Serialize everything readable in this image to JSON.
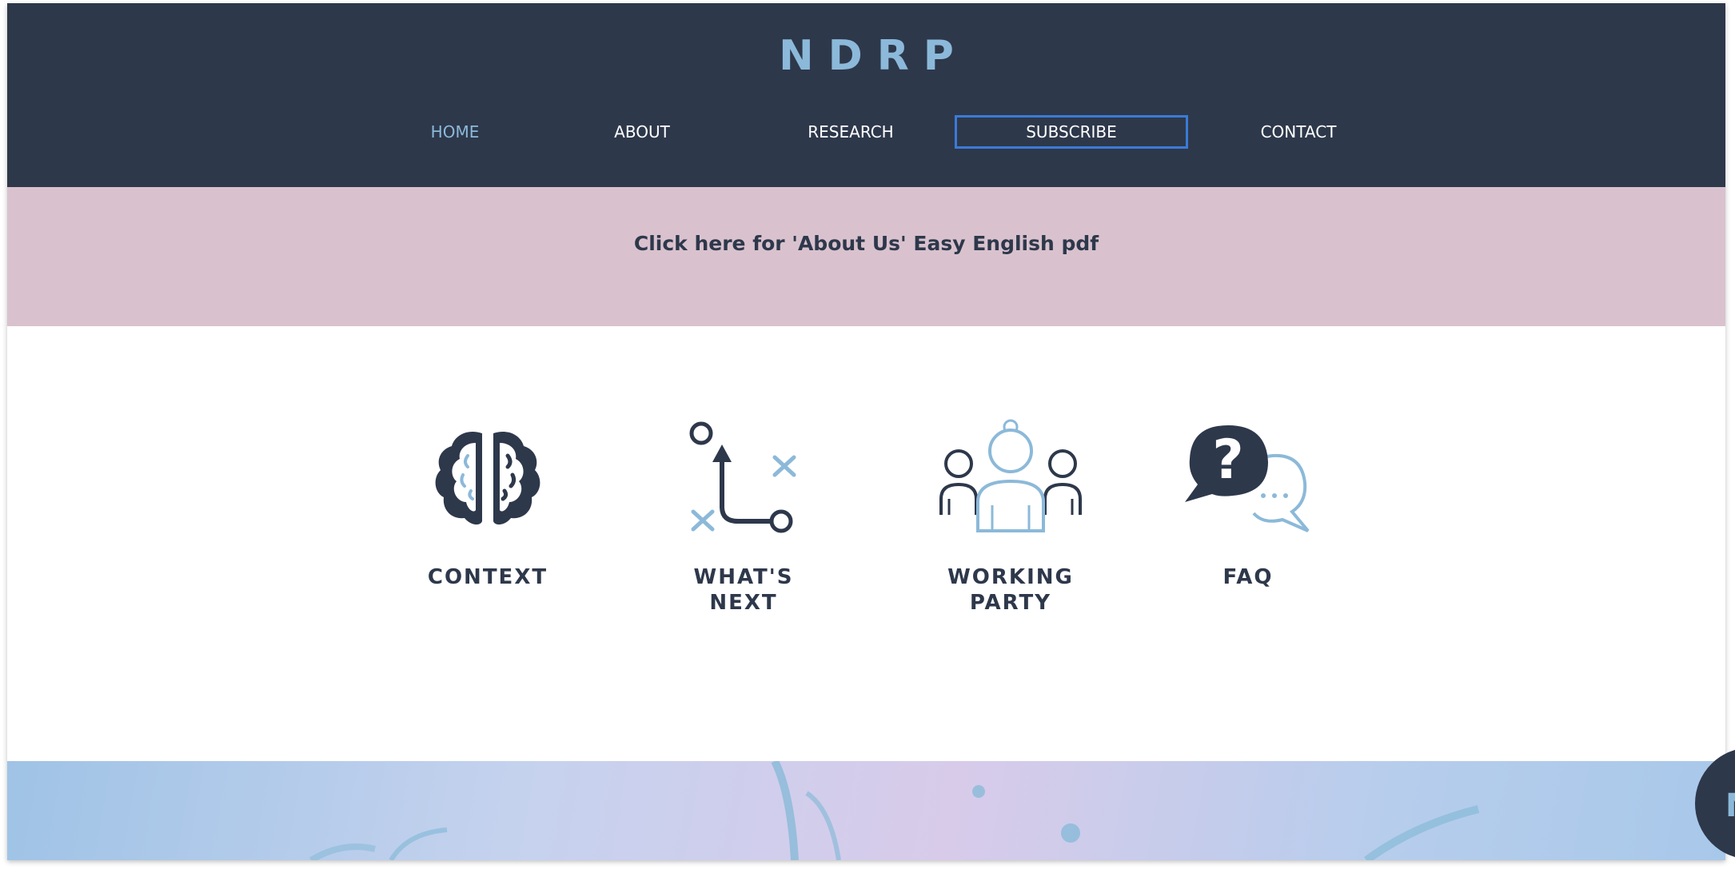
{
  "header": {
    "logo": "NDRP",
    "nav": [
      {
        "label": "HOME"
      },
      {
        "label": "ABOUT"
      },
      {
        "label": "RESEARCH"
      },
      {
        "label": "SUBSCRIBE"
      },
      {
        "label": "CONTACT"
      }
    ]
  },
  "banner": {
    "link_text": "Click here for 'About Us' Easy English pdf"
  },
  "features": [
    {
      "label": "CONTEXT",
      "icon": "brain-icon"
    },
    {
      "label": "WHAT'S\nNEXT",
      "icon": "path-arrow-icon"
    },
    {
      "label": "WORKING\nPARTY",
      "icon": "people-group-icon"
    },
    {
      "label": "FAQ",
      "icon": "question-bubble-icon"
    }
  ],
  "chat": {
    "initial": "N"
  },
  "colors": {
    "header_bg": "#2e384b",
    "accent": "#8cb9d9",
    "banner_bg": "#d9c2ce",
    "focus_outline": "#3b7bd6"
  }
}
